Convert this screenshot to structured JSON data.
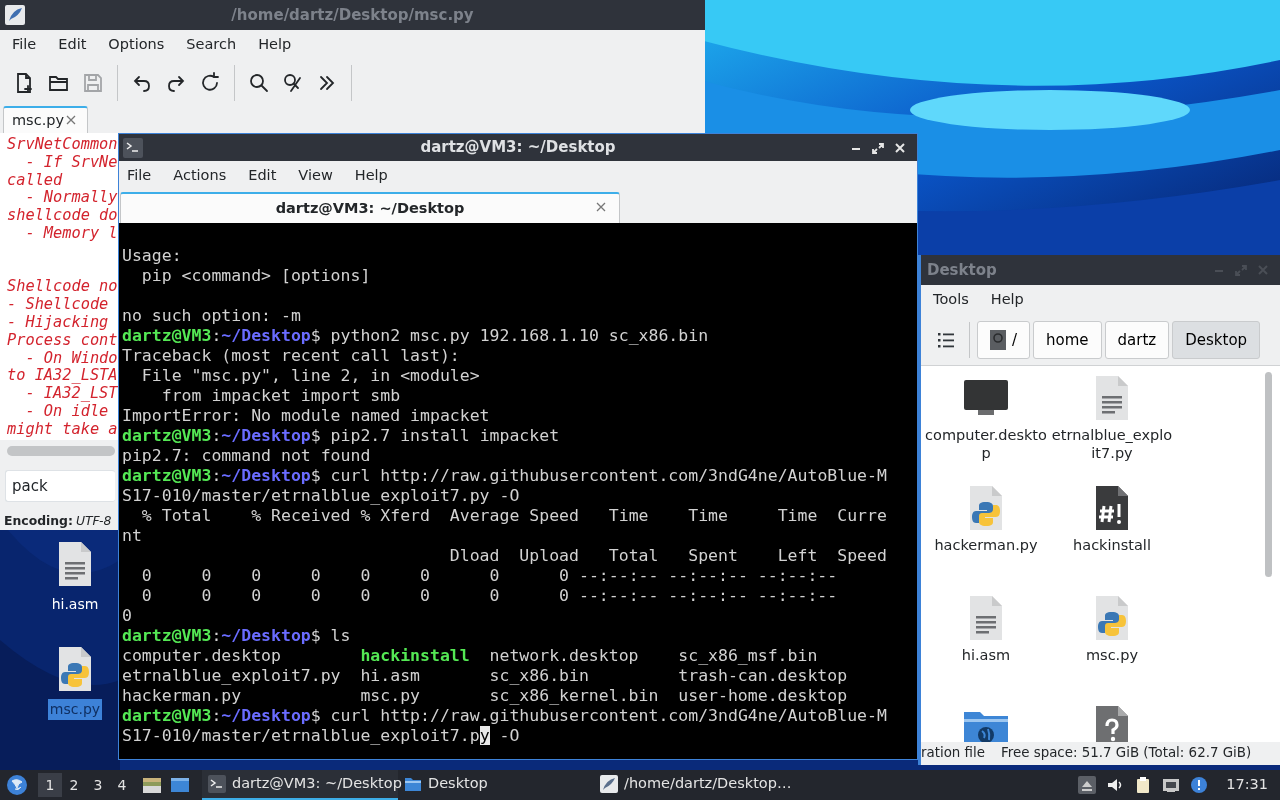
{
  "editor": {
    "title": "/home/dartz/Desktop/msc.py",
    "active": false,
    "menu": [
      "File",
      "Edit",
      "Options",
      "Search",
      "Help"
    ],
    "toolbar": [
      {
        "kind": "new",
        "disabled": false
      },
      {
        "kind": "open",
        "disabled": false
      },
      {
        "kind": "save",
        "disabled": true
      },
      {
        "kind": "sep"
      },
      {
        "kind": "undo",
        "disabled": false
      },
      {
        "kind": "redo",
        "disabled": false
      },
      {
        "kind": "reload",
        "disabled": false
      },
      {
        "kind": "sep"
      },
      {
        "kind": "find",
        "disabled": false
      },
      {
        "kind": "replace",
        "disabled": false
      },
      {
        "kind": "more",
        "disabled": false
      },
      {
        "kind": "sep"
      }
    ],
    "tabs": [
      {
        "label": "msc.py",
        "selected": true
      }
    ],
    "code_blocks": [
      [
        "SrvNetCommon",
        "  - If SrvNe",
        "called",
        "  - Normally",
        "shellcode do",
        "  - Memory l"
      ],
      [
        "Shellcode no",
        "- Shellcode",
        "- Hijacking",
        "Process cont",
        "  - On Windo",
        "to IA32_LSTA",
        "  - IA32_LST",
        "  - On idle",
        "might take a"
      ]
    ],
    "search": {
      "value": "pack"
    },
    "status": {
      "label": "Encoding:",
      "value": "UTF-8"
    }
  },
  "terminal": {
    "title": "dartz@VM3: ~/Desktop",
    "active": true,
    "menu": [
      "File",
      "Actions",
      "Edit",
      "View",
      "Help"
    ],
    "tabs": [
      {
        "label": "dartz@VM3: ~/Desktop",
        "selected": true
      }
    ],
    "blocks": [
      [
        {
          "kind": "out",
          "text": "Usage:"
        },
        {
          "kind": "out",
          "text": "  pip <command> [options]"
        }
      ],
      [
        {
          "kind": "out",
          "text": "no such option: -m"
        },
        {
          "kind": "prompt",
          "user": "dartz@VM3",
          "sep": ":",
          "path": "~/Desktop",
          "command": "$ python2 msc.py 192.168.1.10 sc_x86.bin"
        },
        {
          "kind": "out",
          "text": "Traceback (most recent call last):"
        },
        {
          "kind": "out",
          "text": "  File \"msc.py\", line 2, in <module>"
        },
        {
          "kind": "out",
          "text": "    from impacket import smb"
        },
        {
          "kind": "out",
          "text": "ImportError: No module named impacket"
        },
        {
          "kind": "prompt",
          "user": "dartz@VM3",
          "sep": ":",
          "path": "~/Desktop",
          "command": "$ pip2.7 install impacket"
        },
        {
          "kind": "out",
          "text": "pip2.7: command not found"
        },
        {
          "kind": "prompt",
          "user": "dartz@VM3",
          "sep": ":",
          "path": "~/Desktop",
          "command": "$ curl http://raw.githubusercontent.com/3ndG4ne/AutoBlue-M"
        },
        {
          "kind": "out",
          "text": "S17-010/master/etrnalblue_exploit7.py -O"
        },
        {
          "kind": "out",
          "text": "  % Total    % Received % Xferd  Average Speed   Time    Time     Time  Curre"
        },
        {
          "kind": "out",
          "text": "nt"
        },
        {
          "kind": "out",
          "text": "                                 Dload  Upload   Total   Spent    Left  Speed"
        },
        {
          "kind": "out",
          "text": "  0     0    0     0    0     0      0      0 --:--:-- --:--:-- --:--:--"
        },
        {
          "kind": "out",
          "text": "  0     0    0     0    0     0      0      0 --:--:-- --:--:-- --:--:--"
        },
        {
          "kind": "out",
          "text": "0"
        },
        {
          "kind": "prompt",
          "user": "dartz@VM3",
          "sep": ":",
          "path": "~/Desktop",
          "command": "$ ls"
        },
        {
          "kind": "ls",
          "cells": [
            {
              "text": "computer.desktop",
              "executable": false
            },
            {
              "text": "hackinstall",
              "executable": true
            },
            {
              "text": "network.desktop",
              "executable": false
            },
            {
              "text": "sc_x86_msf.bin",
              "executable": false
            }
          ]
        },
        {
          "kind": "ls",
          "cells": [
            {
              "text": "etrnalblue_exploit7.py",
              "executable": false
            },
            {
              "text": "hi.asm",
              "executable": false
            },
            {
              "text": "sc_x86.bin",
              "executable": false
            },
            {
              "text": "trash-can.desktop",
              "executable": false
            }
          ]
        },
        {
          "kind": "ls",
          "cells": [
            {
              "text": "hackerman.py",
              "executable": false
            },
            {
              "text": "msc.py",
              "executable": false
            },
            {
              "text": "sc_x86_kernel.bin",
              "executable": false
            },
            {
              "text": "user-home.desktop",
              "executable": false
            }
          ]
        },
        {
          "kind": "prompt",
          "user": "dartz@VM3",
          "sep": ":",
          "path": "~/Desktop",
          "command": "$ curl http://raw.githubusercontent.com/3ndG4ne/AutoBlue-M"
        },
        {
          "kind": "cursor",
          "text": "S17-010/master/etrnalblue_exploit7.p",
          "under_cursor": "y",
          "after": " -O"
        }
      ]
    ]
  },
  "file_manager": {
    "title": "Desktop",
    "active": false,
    "menu": [
      "Tools",
      "Help"
    ],
    "path": [
      {
        "label": "/",
        "kind": "root",
        "selected": false
      },
      {
        "label": "home",
        "kind": "dir",
        "selected": false
      },
      {
        "label": "dartz",
        "kind": "dir",
        "selected": false
      },
      {
        "label": "Desktop",
        "kind": "dir",
        "selected": true
      }
    ],
    "items": [
      {
        "name": "computer.desktop",
        "kind": "monitor"
      },
      {
        "name": "etrnalblue_exploit7.py",
        "kind": "text"
      },
      {
        "name": "hackerman.py",
        "kind": "python"
      },
      {
        "name": "hackinstall",
        "kind": "script"
      },
      {
        "name": "hi.asm",
        "kind": "text"
      },
      {
        "name": "msc.py",
        "kind": "python"
      },
      {
        "kind": "network"
      },
      {
        "kind": "unknown"
      }
    ],
    "status": [
      "ration file",
      "Free space: 51.7 GiB (Total: 62.7 GiB)"
    ]
  },
  "desktop_icons": [
    {
      "name": "hi.asm",
      "kind": "text",
      "selected": false
    },
    {
      "name": "msc.py",
      "kind": "python",
      "selected": true
    }
  ],
  "taskbar": {
    "workspaces": [
      {
        "label": "1",
        "selected": true
      },
      {
        "label": "2",
        "selected": false
      },
      {
        "label": "3",
        "selected": false
      },
      {
        "label": "4",
        "selected": false
      }
    ],
    "launchers": [
      {
        "kind": "files"
      },
      {
        "kind": "desktop"
      }
    ],
    "tasks": [
      {
        "label": "dartz@VM3: ~/Desktop",
        "kind": "terminal",
        "selected": true
      },
      {
        "label": "Desktop",
        "kind": "folder",
        "selected": false
      },
      {
        "label": "/home/dartz/Desktop…",
        "kind": "editor",
        "selected": false
      }
    ],
    "tray": [
      {
        "kind": "arrow"
      },
      {
        "kind": "volume"
      },
      {
        "kind": "clipboard"
      },
      {
        "kind": "network"
      },
      {
        "kind": "notify"
      }
    ],
    "clock": "17:31"
  }
}
